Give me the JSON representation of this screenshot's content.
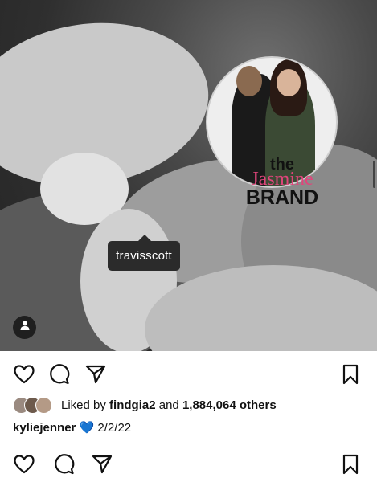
{
  "photo": {
    "tagged_user": "travisscott",
    "watermark": {
      "line1": "the",
      "line2": "Jasmine",
      "line3": "BRAND"
    }
  },
  "actions": {
    "icons": [
      "heart-icon",
      "comment-icon",
      "share-icon",
      "bookmark-icon"
    ]
  },
  "likes": {
    "prefix": "Liked by",
    "user": "findgia2",
    "joiner": "and",
    "count": "1,884,064 others"
  },
  "caption": {
    "username": "kyliejenner",
    "emoji": "💙",
    "text": "2/2/22"
  },
  "colors": {
    "accent_blue": "#3b7be0",
    "brand_pink": "#e0457b"
  }
}
